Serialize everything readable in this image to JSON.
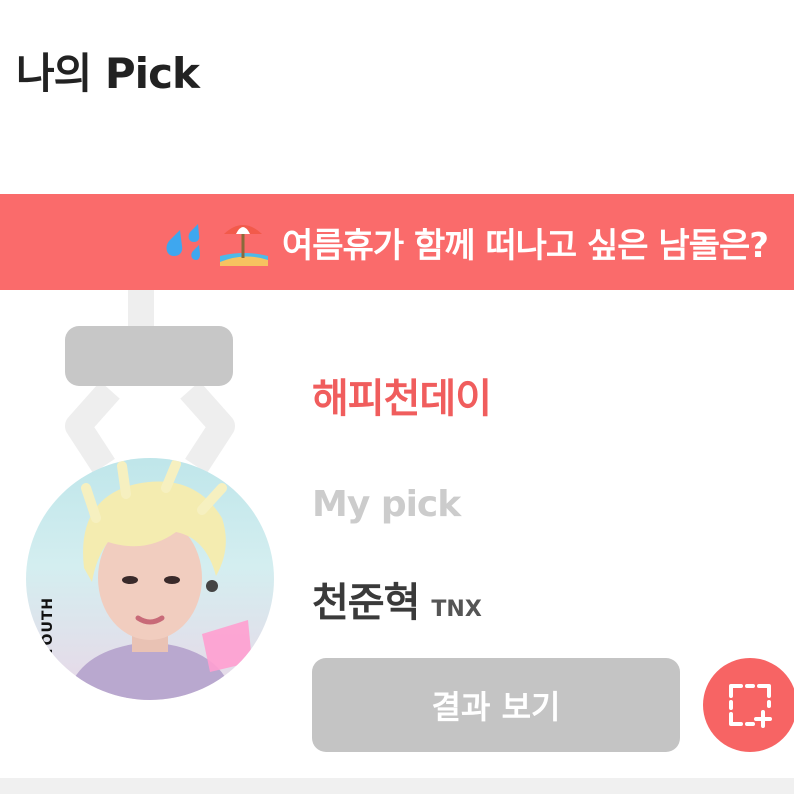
{
  "header": {
    "title": "나의 Pick"
  },
  "banner": {
    "text": "여름휴가 함께 떠나고 싶은 남돌은?",
    "emoji_icons": [
      "droplets-icon",
      "beach-umbrella-icon"
    ],
    "color": "#fa6b6b"
  },
  "card": {
    "title": "해피천데이",
    "section_label": "My pick",
    "pick": {
      "name": "천준혁",
      "group": "TNX"
    },
    "photo": {
      "side_text": "YOURYOUTH"
    },
    "result_button": "결과 보기",
    "capture_button_icon": "screenshot-icon"
  },
  "colors": {
    "accent": "#f05d5d",
    "button_gray": "#c4c4c4"
  }
}
